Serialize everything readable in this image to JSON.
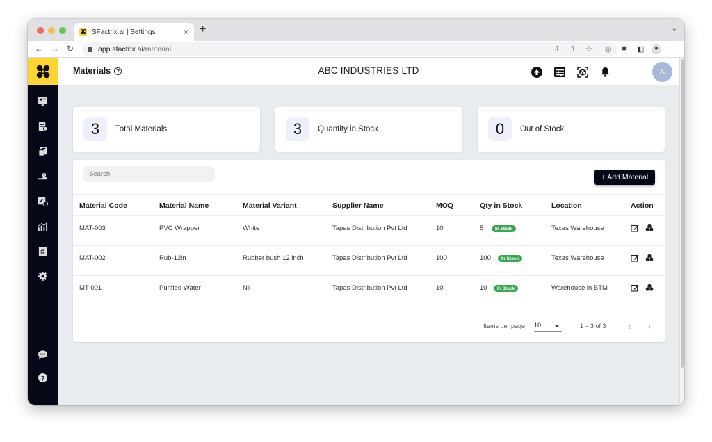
{
  "browser": {
    "tab_title": "SFactrix.ai | Settings",
    "url_host": "app.sfactrix.ai",
    "url_path": "/material",
    "new_tab": "+",
    "close_tab": "×"
  },
  "header": {
    "page_title": "Materials",
    "help": "?",
    "company": "ABC INDUSTRIES LTD",
    "avatar_initial": "A"
  },
  "summary_cards": [
    {
      "value": "3",
      "label": "Total Materials"
    },
    {
      "value": "3",
      "label": "Quantity in Stock"
    },
    {
      "value": "0",
      "label": "Out of Stock"
    }
  ],
  "toolbar": {
    "search_placeholder": "Search",
    "add_button": "+ Add Material"
  },
  "table": {
    "columns": [
      "Material Code",
      "Material Name",
      "Material Variant",
      "Supplier Name",
      "MOQ",
      "Qty in Stock",
      "Location",
      "Action"
    ],
    "rows": [
      {
        "code": "MAT-003",
        "name": "PVC Wrapper",
        "variant": "White",
        "supplier": "Tapas Distribution Pvt Ltd",
        "moq": "10",
        "qty": "5",
        "status": "In Stock",
        "location": "Texas Warehouse"
      },
      {
        "code": "MAT-002",
        "name": "Rub-12in",
        "variant": "Rubber bush 12 inch",
        "supplier": "Tapas Distribution Pvt Ltd",
        "moq": "100",
        "qty": "100",
        "status": "In Stock",
        "location": "Texas Warehouse"
      },
      {
        "code": "MT-001",
        "name": "Purified Water",
        "variant": "Nil",
        "supplier": "Tapas Distribution Pvt Ltd",
        "moq": "10",
        "qty": "10",
        "status": "In Stock",
        "location": "Warehouse in BTM"
      }
    ]
  },
  "pagination": {
    "items_per_page_label": "Items per page:",
    "items_per_page": "10",
    "range": "1 – 3 of 3",
    "prev": "‹",
    "next": "›"
  },
  "colors": {
    "brand_yellow": "#fcd535",
    "sidebar_bg": "#050816",
    "badge_green": "#3aa552"
  }
}
